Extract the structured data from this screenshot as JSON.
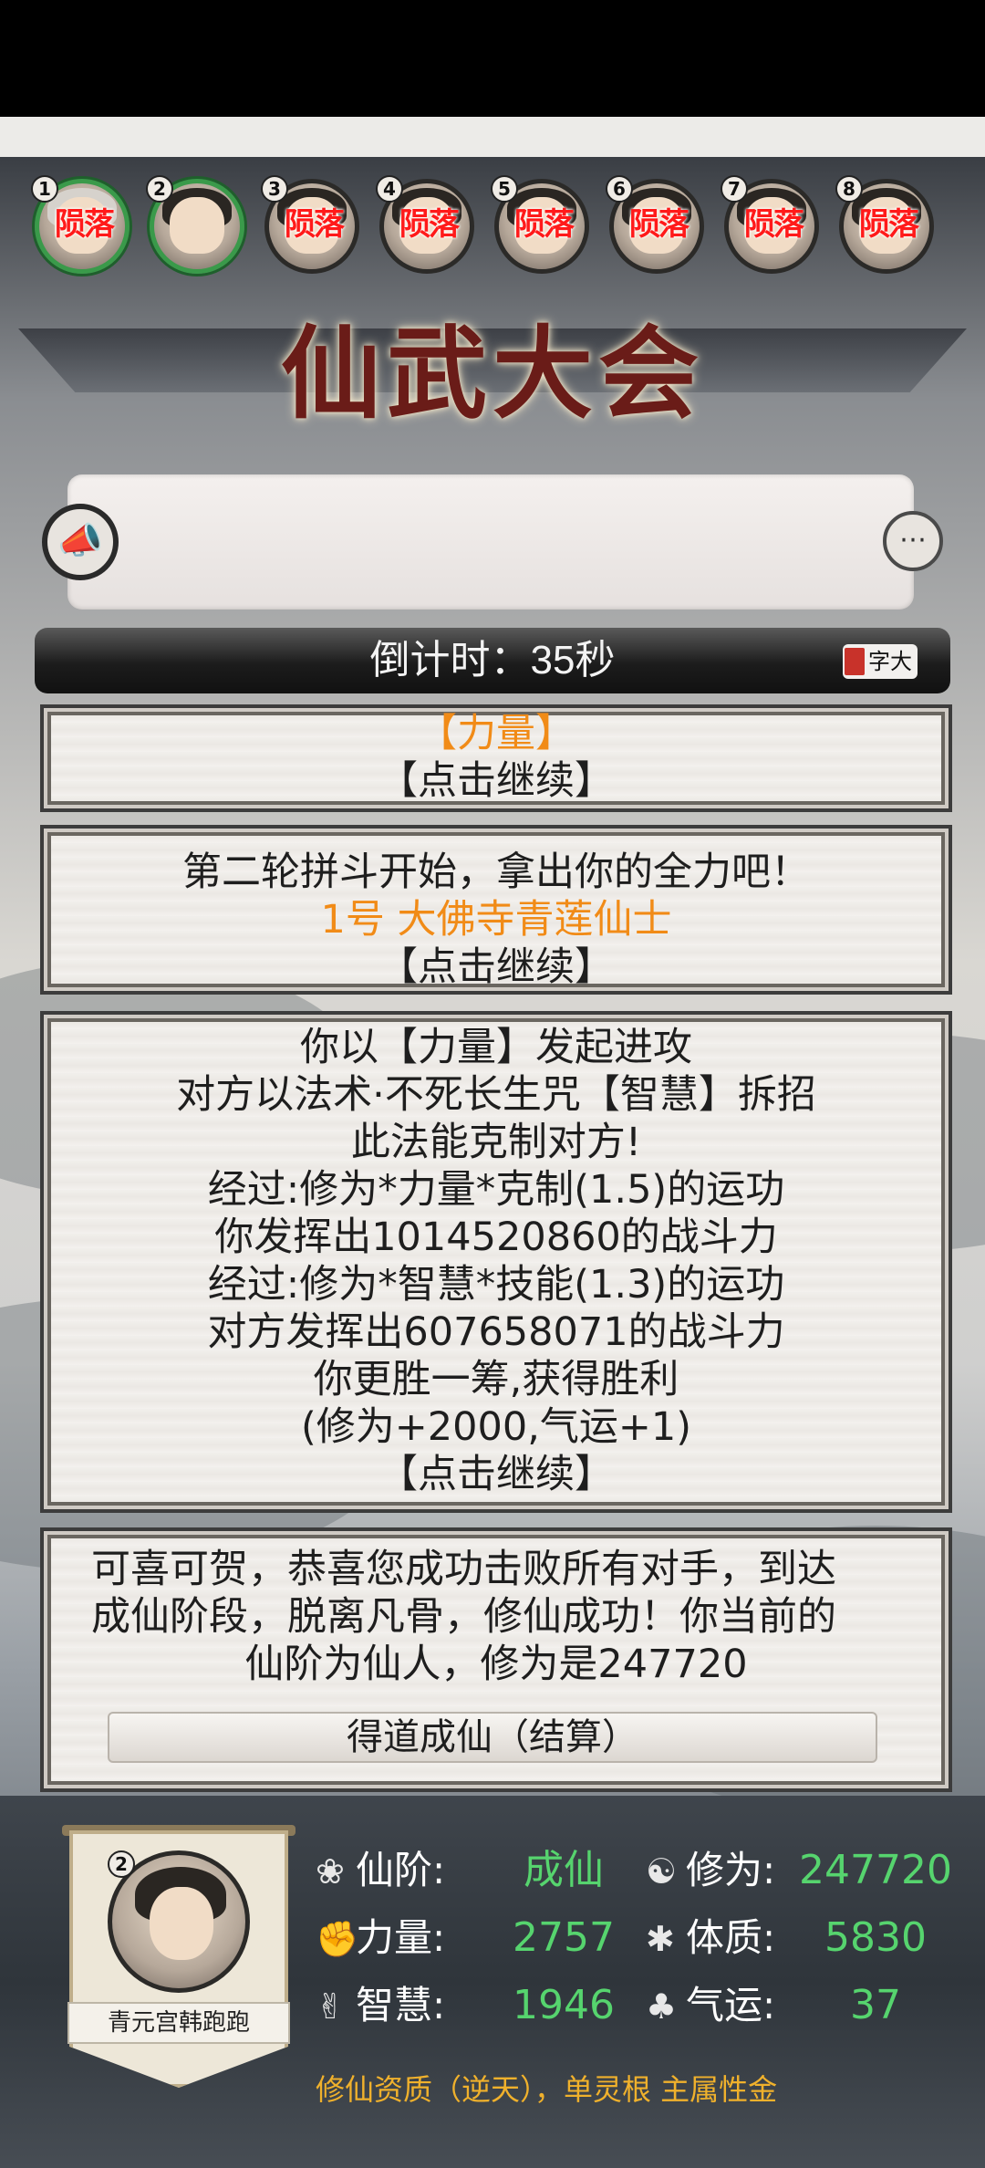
{
  "players": [
    {
      "number": "1",
      "status": "陨落",
      "alive": true,
      "hair": "light"
    },
    {
      "number": "2",
      "status": "",
      "alive": true,
      "hair": "dark"
    },
    {
      "number": "3",
      "status": "陨落",
      "alive": false,
      "hair": "dark"
    },
    {
      "number": "4",
      "status": "陨落",
      "alive": false,
      "hair": "dark"
    },
    {
      "number": "5",
      "status": "陨落",
      "alive": false,
      "hair": "dark"
    },
    {
      "number": "6",
      "status": "陨落",
      "alive": false,
      "hair": "dark"
    },
    {
      "number": "7",
      "status": "陨落",
      "alive": false,
      "hair": "dark"
    },
    {
      "number": "8",
      "status": "陨落",
      "alive": false,
      "hair": "dark"
    }
  ],
  "title": "仙武大会",
  "announcement": {
    "text": ""
  },
  "countdown": {
    "text": "倒计时：35秒"
  },
  "font_toggle": {
    "label": "字大"
  },
  "log": {
    "card1": {
      "line1": "【力量】",
      "line2": "【点击继续】"
    },
    "card2": {
      "line1": "第二轮拼斗开始，拿出你的全力吧！",
      "line2": "1号 大佛寺青莲仙士",
      "line3": "【点击继续】"
    },
    "card3": {
      "lines": [
        "你以【力量】发起进攻",
        "对方以法术·不死长生咒【智慧】拆招",
        "此法能克制对方!",
        "经过:修为*力量*克制(1.5)的运功",
        "你发挥出1014520860的战斗力",
        "经过:修为*智慧*技能(1.3)的运功",
        "对方发挥出607658071的战斗力",
        "你更胜一筹,获得胜利",
        "(修为+2000,气运+1)",
        "【点击继续】"
      ]
    },
    "card4": {
      "lines": [
        "可喜可贺，恭喜您成功击败所有对手，到达",
        "成仙阶段，脱离凡骨，修仙成功！你当前的",
        "仙阶为仙人，修为是247720"
      ],
      "button": "得道成仙（结算）"
    }
  },
  "me": {
    "number": "2",
    "name": "青元宫韩跑跑",
    "stats": {
      "rank_label": "仙阶:",
      "rank_value": "成仙",
      "cultivation_label": "修为:",
      "cultivation_value": "247720",
      "strength_label": "力量:",
      "strength_value": "2757",
      "constitution_label": "体质:",
      "constitution_value": "5830",
      "wisdom_label": "智慧:",
      "wisdom_value": "1946",
      "luck_label": "气运:",
      "luck_value": "37"
    },
    "aptitude": "修仙资质（逆天），单灵根 主属性金"
  },
  "colors": {
    "highlight_orange": "#f18b17",
    "stat_green": "#56d46e",
    "dead_red": "#ff1a1a",
    "aptitude_gold": "#f0b12c"
  }
}
